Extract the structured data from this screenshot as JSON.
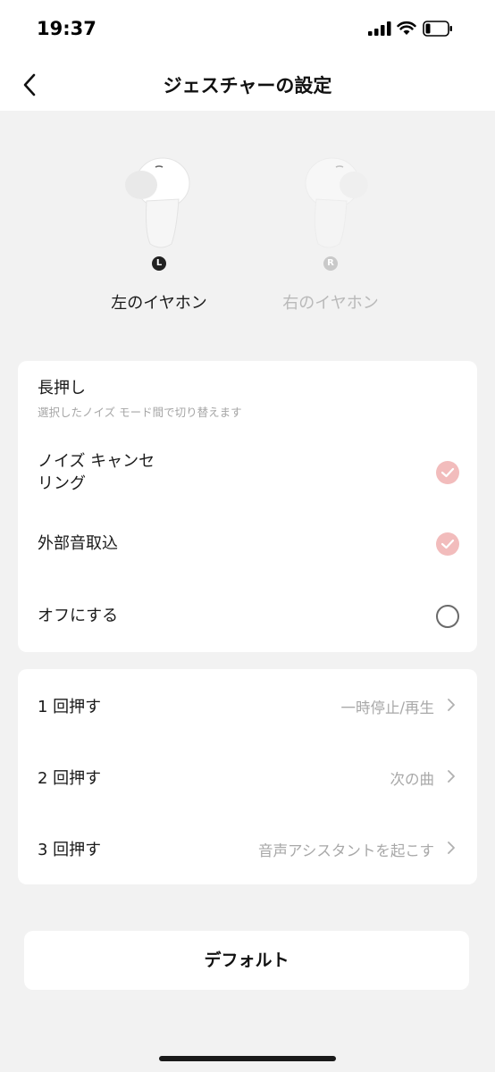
{
  "status_bar": {
    "time": "19:37"
  },
  "header": {
    "title": "ジェスチャーの設定"
  },
  "earbuds": {
    "left": {
      "badge": "L",
      "label": "左のイヤホン",
      "selected": true
    },
    "right": {
      "badge": "R",
      "label": "右のイヤホン",
      "selected": false
    }
  },
  "long_press": {
    "title": "長押し",
    "subtitle": "選択したノイズ モード間で切り替えます",
    "options": [
      {
        "label_line1": "ノイズ キャンセ",
        "label_line2": "リング",
        "checked": true
      },
      {
        "label": "外部音取込",
        "checked": true
      },
      {
        "label": "オフにする",
        "checked": false
      }
    ]
  },
  "press_actions": [
    {
      "label": "1 回押す",
      "value": "一時停止/再生"
    },
    {
      "label": "2 回押す",
      "value": "次の曲"
    },
    {
      "label": "3 回押す",
      "value": "音声アシスタントを起こす"
    }
  ],
  "default_button": {
    "label": "デフォルト"
  },
  "colors": {
    "accent_check": "#f2bcbc",
    "background": "#f2f2f2",
    "card": "#ffffff"
  }
}
